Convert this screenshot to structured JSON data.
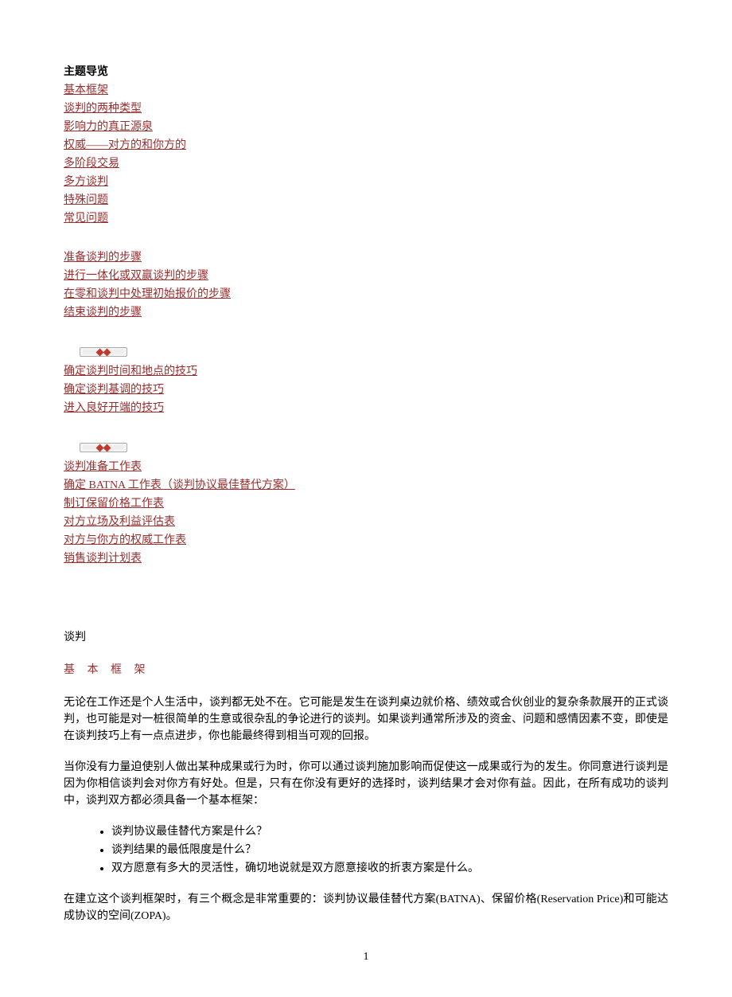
{
  "nav": {
    "title": "主题导览",
    "group1": [
      "基本框架",
      "谈判的两种类型",
      "影响力的真正源泉",
      "权威——对方的和你方的",
      "多阶段交易",
      "多方谈判",
      "特殊问题",
      "常见问题"
    ],
    "group2": [
      "准备谈判的步骤",
      "进行一体化或双赢谈判的步骤",
      "在零和谈判中处理初始报价的步骤",
      "结束谈判的步骤"
    ],
    "group3": [
      "确定谈判时间和地点的技巧",
      "确定谈判基调的技巧",
      "进入良好开端的技巧"
    ],
    "group4": [
      "谈判准备工作表",
      "确定 BATNA 工作表（谈判协议最佳替代方案）",
      "制订保留价格工作表",
      "对方立场及利益评估表",
      "对方与你方的权威工作表",
      "销售谈判计划表"
    ]
  },
  "content": {
    "topic_label": "谈判",
    "heading": "基 本 框 架",
    "para1": "无论在工作还是个人生活中，谈判都无处不在。它可能是发生在谈判桌边就价格、绩效或合伙创业的复杂条款展开的正式谈判，也可能是对一桩很简单的生意或很杂乱的争论进行的谈判。如果谈判通常所涉及的资金、问题和感情因素不变，即使是在谈判技巧上有一点点进步，你也能最终得到相当可观的回报。",
    "para2": "当你没有力量迫使别人做出某种成果或行为时，你可以通过谈判施加影响而促使这一成果或行为的发生。你同意进行谈判是因为你相信谈判会对你方有好处。但是，只有在你没有更好的选择时，谈判结果才会对你有益。因此，在所有成功的谈判中，谈判双方都必须具备一个基本框架：",
    "bullets": [
      "谈判协议最佳替代方案是什么？",
      "谈判结果的最低限度是什么？",
      "双方愿意有多大的灵活性，确切地说就是双方愿意接收的折衷方案是什么。"
    ],
    "para3": "在建立这个谈判框架时，有三个概念是非常重要的：谈判协议最佳替代方案(BATNA)、保留价格(Reservation Price)和可能达成协议的空间(ZOPA)。"
  },
  "page_number": "1"
}
